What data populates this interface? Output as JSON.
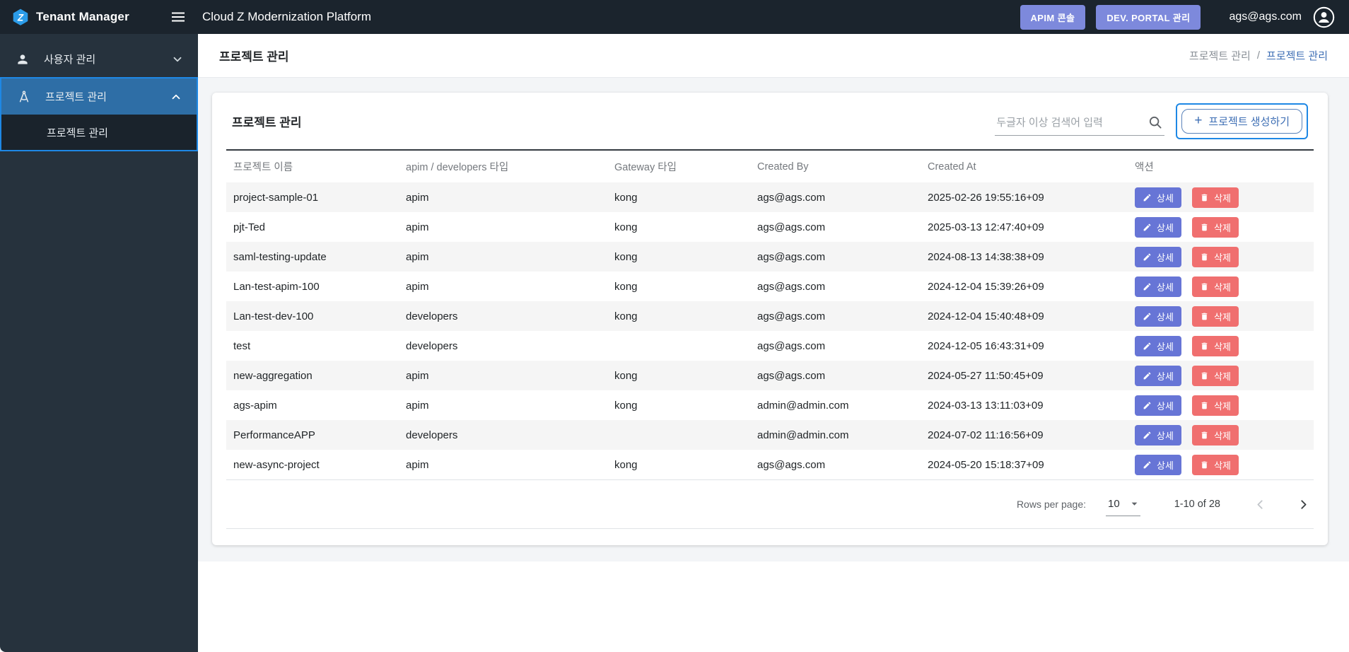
{
  "header": {
    "brand": "Tenant Manager",
    "app_title": "Cloud Z Modernization Platform",
    "buttons": [
      {
        "label": "APIM 콘솔"
      },
      {
        "label": "DEV. PORTAL 관리"
      }
    ],
    "user_email": "ags@ags.com"
  },
  "sidebar": {
    "items": [
      {
        "label": "사용자 관리",
        "icon": "person-icon",
        "expanded": false
      },
      {
        "label": "프로젝트 관리",
        "icon": "compass-icon",
        "expanded": true,
        "selected": true,
        "children": [
          {
            "label": "프로젝트 관리"
          }
        ]
      }
    ]
  },
  "page": {
    "title": "프로젝트 관리",
    "breadcrumb": [
      "프로젝트 관리",
      "프로젝트 관리"
    ],
    "breadcrumb_separator": "/"
  },
  "panel": {
    "title": "프로젝트 관리",
    "search_placeholder": "두글자 이상 검색어 입력",
    "create_button_plus": "+",
    "create_button_label": "프로젝트 생성하기"
  },
  "table": {
    "columns": [
      "프로젝트 이름",
      "apim / developers 타입",
      "Gateway 타입",
      "Created By",
      "Created At",
      "액션"
    ],
    "action_labels": {
      "detail": "상세",
      "delete": "삭제"
    },
    "rows": [
      {
        "name": "project-sample-01",
        "type": "apim",
        "gateway": "kong",
        "created_by": "ags@ags.com",
        "created_at": "2025-02-26 19:55:16+09"
      },
      {
        "name": "pjt-Ted",
        "type": "apim",
        "gateway": "kong",
        "created_by": "ags@ags.com",
        "created_at": "2025-03-13 12:47:40+09"
      },
      {
        "name": "saml-testing-update",
        "type": "apim",
        "gateway": "kong",
        "created_by": "ags@ags.com",
        "created_at": "2024-08-13 14:38:38+09"
      },
      {
        "name": "Lan-test-apim-100",
        "type": "apim",
        "gateway": "kong",
        "created_by": "ags@ags.com",
        "created_at": "2024-12-04 15:39:26+09"
      },
      {
        "name": "Lan-test-dev-100",
        "type": "developers",
        "gateway": "kong",
        "created_by": "ags@ags.com",
        "created_at": "2024-12-04 15:40:48+09"
      },
      {
        "name": "test",
        "type": "developers",
        "gateway": "",
        "created_by": "ags@ags.com",
        "created_at": "2024-12-05 16:43:31+09"
      },
      {
        "name": "new-aggregation",
        "type": "apim",
        "gateway": "kong",
        "created_by": "ags@ags.com",
        "created_at": "2024-05-27 11:50:45+09"
      },
      {
        "name": "ags-apim",
        "type": "apim",
        "gateway": "kong",
        "created_by": "admin@admin.com",
        "created_at": "2024-03-13 13:11:03+09"
      },
      {
        "name": "PerformanceAPP",
        "type": "developers",
        "gateway": "",
        "created_by": "admin@admin.com",
        "created_at": "2024-07-02 11:16:56+09"
      },
      {
        "name": "new-async-project",
        "type": "apim",
        "gateway": "kong",
        "created_by": "ags@ags.com",
        "created_at": "2024-05-20 15:18:37+09"
      }
    ]
  },
  "pagination": {
    "rows_per_page_label": "Rows per page:",
    "rows_per_page_value": "10",
    "range_label": "1-10 of 28"
  },
  "colors": {
    "topbar_bg": "#1b242d",
    "sidebar_bg": "#26323d",
    "sidebar_selected_bg": "#2e6ea6",
    "accent_blue": "#1e88e5",
    "header_button": "#7d89dc",
    "detail_button": "#6775d6",
    "delete_button": "#f06f6f",
    "link_blue": "#3d6eb4",
    "row_stripe": "#f5f5f5"
  }
}
